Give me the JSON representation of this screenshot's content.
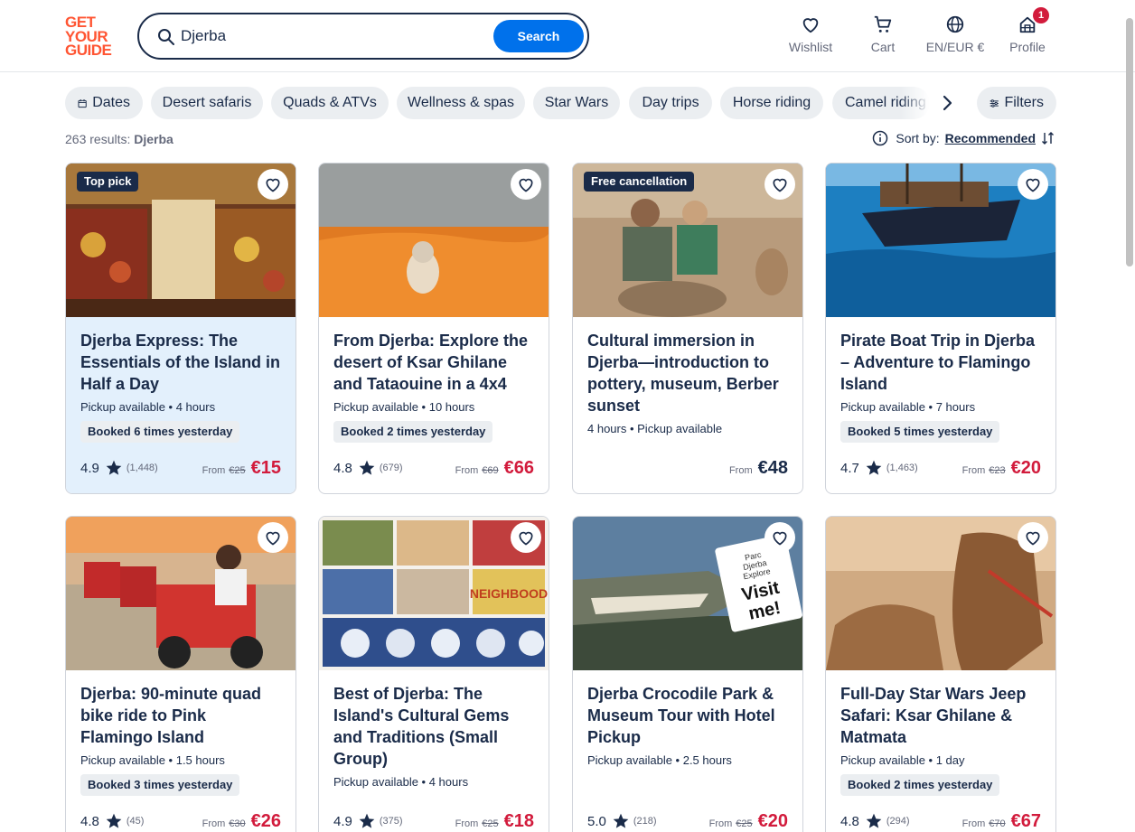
{
  "header": {
    "logo_lines": [
      "GET",
      "YOUR",
      "GUIDE"
    ],
    "search": {
      "value": "Djerba",
      "button": "Search"
    },
    "nav": [
      {
        "label": "Wishlist",
        "icon": "heart-icon"
      },
      {
        "label": "Cart",
        "icon": "cart-icon"
      },
      {
        "label": "EN/EUR €",
        "icon": "globe-icon"
      },
      {
        "label": "Profile",
        "icon": "profile-icon",
        "badge": "1"
      }
    ]
  },
  "chips": [
    "Dates",
    "Desert safaris",
    "Quads & ATVs",
    "Wellness & spas",
    "Star Wars",
    "Day trips",
    "Horse riding",
    "Camel riding",
    "Filters"
  ],
  "results": {
    "count_text": "263 results:",
    "query": "Djerba"
  },
  "sort": {
    "label": "Sort by:",
    "value": "Recommended"
  },
  "colors": {
    "accent": "#0071eb",
    "brand": "#ff5533",
    "price": "#d21b3c",
    "text": "#1a2b49"
  },
  "cards": [
    {
      "tag": "Top pick",
      "title": "Djerba Express: The Essentials of the Island in Half a Day",
      "meta": "Pickup available • 4 hours",
      "booked": "Booked 6 times yesterday",
      "rating": "4.9",
      "reviews": "(1,448)",
      "from": "From",
      "old_price": "€25",
      "price": "€15"
    },
    {
      "tag": "",
      "title": "From Djerba: Explore the desert of Ksar Ghilane and Tataouine in a 4x4",
      "meta": "Pickup available • 10 hours",
      "booked": "Booked 2 times yesterday",
      "rating": "4.8",
      "reviews": "(679)",
      "from": "From",
      "old_price": "€69",
      "price": "€66"
    },
    {
      "tag": "Free cancellation",
      "title": "Cultural immersion in Djerba—introduction to pottery, museum, Berber sunset",
      "meta": "4 hours • Pickup available",
      "booked": "",
      "rating": "",
      "reviews": "",
      "from": "From",
      "old_price": "",
      "price": "€48"
    },
    {
      "tag": "",
      "title": "Pirate Boat Trip in Djerba – Adventure to Flamingo Island",
      "meta": "Pickup available • 7 hours",
      "booked": "Booked 5 times yesterday",
      "rating": "4.7",
      "reviews": "(1,463)",
      "from": "From",
      "old_price": "€23",
      "price": "€20"
    },
    {
      "tag": "",
      "title": "Djerba: 90-minute quad bike ride to Pink Flamingo Island",
      "meta": "Pickup available • 1.5 hours",
      "booked": "Booked 3 times yesterday",
      "rating": "4.8",
      "reviews": "(45)",
      "from": "From",
      "old_price": "€30",
      "price": "€26"
    },
    {
      "tag": "",
      "title": "Best of Djerba: The Island's Cultural Gems and Traditions (Small Group)",
      "meta": "Pickup available • 4 hours",
      "booked": "",
      "rating": "4.9",
      "reviews": "(375)",
      "from": "From",
      "old_price": "€25",
      "price": "€18"
    },
    {
      "tag": "",
      "title": "Djerba Crocodile Park & Museum Tour with Hotel Pickup",
      "meta": "Pickup available • 2.5 hours",
      "booked": "",
      "rating": "5.0",
      "reviews": "(218)",
      "from": "From",
      "old_price": "€25",
      "price": "€20",
      "img_text": [
        "Parc",
        "Djerba",
        "Explore",
        "Visit",
        "me!"
      ]
    },
    {
      "tag": "",
      "title": "Full-Day Star Wars Jeep Safari: Ksar Ghilane & Matmata",
      "meta": "Pickup available • 1 day",
      "booked": "Booked 2 times yesterday",
      "rating": "4.8",
      "reviews": "(294)",
      "from": "From",
      "old_price": "€70",
      "price": "€67"
    }
  ],
  "image_texts": {
    "neighbourhood_sign": "NEIGHBOOD"
  }
}
